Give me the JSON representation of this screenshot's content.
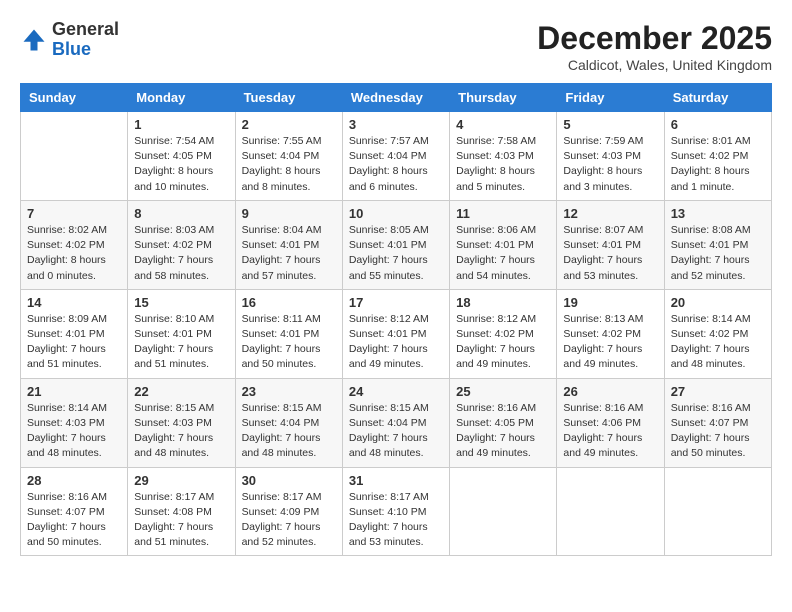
{
  "header": {
    "logo_general": "General",
    "logo_blue": "Blue",
    "title": "December 2025",
    "subtitle": "Caldicot, Wales, United Kingdom"
  },
  "days_of_week": [
    "Sunday",
    "Monday",
    "Tuesday",
    "Wednesday",
    "Thursday",
    "Friday",
    "Saturday"
  ],
  "weeks": [
    [
      {
        "day": "",
        "info": ""
      },
      {
        "day": "1",
        "info": "Sunrise: 7:54 AM\nSunset: 4:05 PM\nDaylight: 8 hours\nand 10 minutes."
      },
      {
        "day": "2",
        "info": "Sunrise: 7:55 AM\nSunset: 4:04 PM\nDaylight: 8 hours\nand 8 minutes."
      },
      {
        "day": "3",
        "info": "Sunrise: 7:57 AM\nSunset: 4:04 PM\nDaylight: 8 hours\nand 6 minutes."
      },
      {
        "day": "4",
        "info": "Sunrise: 7:58 AM\nSunset: 4:03 PM\nDaylight: 8 hours\nand 5 minutes."
      },
      {
        "day": "5",
        "info": "Sunrise: 7:59 AM\nSunset: 4:03 PM\nDaylight: 8 hours\nand 3 minutes."
      },
      {
        "day": "6",
        "info": "Sunrise: 8:01 AM\nSunset: 4:02 PM\nDaylight: 8 hours\nand 1 minute."
      }
    ],
    [
      {
        "day": "7",
        "info": "Sunrise: 8:02 AM\nSunset: 4:02 PM\nDaylight: 8 hours\nand 0 minutes."
      },
      {
        "day": "8",
        "info": "Sunrise: 8:03 AM\nSunset: 4:02 PM\nDaylight: 7 hours\nand 58 minutes."
      },
      {
        "day": "9",
        "info": "Sunrise: 8:04 AM\nSunset: 4:01 PM\nDaylight: 7 hours\nand 57 minutes."
      },
      {
        "day": "10",
        "info": "Sunrise: 8:05 AM\nSunset: 4:01 PM\nDaylight: 7 hours\nand 55 minutes."
      },
      {
        "day": "11",
        "info": "Sunrise: 8:06 AM\nSunset: 4:01 PM\nDaylight: 7 hours\nand 54 minutes."
      },
      {
        "day": "12",
        "info": "Sunrise: 8:07 AM\nSunset: 4:01 PM\nDaylight: 7 hours\nand 53 minutes."
      },
      {
        "day": "13",
        "info": "Sunrise: 8:08 AM\nSunset: 4:01 PM\nDaylight: 7 hours\nand 52 minutes."
      }
    ],
    [
      {
        "day": "14",
        "info": "Sunrise: 8:09 AM\nSunset: 4:01 PM\nDaylight: 7 hours\nand 51 minutes."
      },
      {
        "day": "15",
        "info": "Sunrise: 8:10 AM\nSunset: 4:01 PM\nDaylight: 7 hours\nand 51 minutes."
      },
      {
        "day": "16",
        "info": "Sunrise: 8:11 AM\nSunset: 4:01 PM\nDaylight: 7 hours\nand 50 minutes."
      },
      {
        "day": "17",
        "info": "Sunrise: 8:12 AM\nSunset: 4:01 PM\nDaylight: 7 hours\nand 49 minutes."
      },
      {
        "day": "18",
        "info": "Sunrise: 8:12 AM\nSunset: 4:02 PM\nDaylight: 7 hours\nand 49 minutes."
      },
      {
        "day": "19",
        "info": "Sunrise: 8:13 AM\nSunset: 4:02 PM\nDaylight: 7 hours\nand 49 minutes."
      },
      {
        "day": "20",
        "info": "Sunrise: 8:14 AM\nSunset: 4:02 PM\nDaylight: 7 hours\nand 48 minutes."
      }
    ],
    [
      {
        "day": "21",
        "info": "Sunrise: 8:14 AM\nSunset: 4:03 PM\nDaylight: 7 hours\nand 48 minutes."
      },
      {
        "day": "22",
        "info": "Sunrise: 8:15 AM\nSunset: 4:03 PM\nDaylight: 7 hours\nand 48 minutes."
      },
      {
        "day": "23",
        "info": "Sunrise: 8:15 AM\nSunset: 4:04 PM\nDaylight: 7 hours\nand 48 minutes."
      },
      {
        "day": "24",
        "info": "Sunrise: 8:15 AM\nSunset: 4:04 PM\nDaylight: 7 hours\nand 48 minutes."
      },
      {
        "day": "25",
        "info": "Sunrise: 8:16 AM\nSunset: 4:05 PM\nDaylight: 7 hours\nand 49 minutes."
      },
      {
        "day": "26",
        "info": "Sunrise: 8:16 AM\nSunset: 4:06 PM\nDaylight: 7 hours\nand 49 minutes."
      },
      {
        "day": "27",
        "info": "Sunrise: 8:16 AM\nSunset: 4:07 PM\nDaylight: 7 hours\nand 50 minutes."
      }
    ],
    [
      {
        "day": "28",
        "info": "Sunrise: 8:16 AM\nSunset: 4:07 PM\nDaylight: 7 hours\nand 50 minutes."
      },
      {
        "day": "29",
        "info": "Sunrise: 8:17 AM\nSunset: 4:08 PM\nDaylight: 7 hours\nand 51 minutes."
      },
      {
        "day": "30",
        "info": "Sunrise: 8:17 AM\nSunset: 4:09 PM\nDaylight: 7 hours\nand 52 minutes."
      },
      {
        "day": "31",
        "info": "Sunrise: 8:17 AM\nSunset: 4:10 PM\nDaylight: 7 hours\nand 53 minutes."
      },
      {
        "day": "",
        "info": ""
      },
      {
        "day": "",
        "info": ""
      },
      {
        "day": "",
        "info": ""
      }
    ]
  ]
}
